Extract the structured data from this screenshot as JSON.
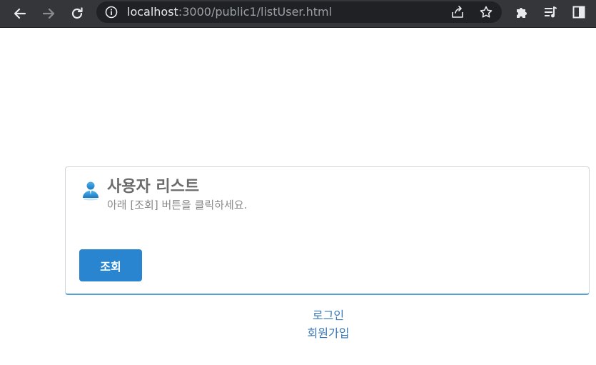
{
  "browser": {
    "url_host": "localhost",
    "url_path": ":3000/public1/listUser.html",
    "icons": [
      "back-arrow-icon",
      "forward-arrow-icon",
      "reload-icon",
      "info-icon",
      "share-icon",
      "star-icon",
      "puzzle-icon",
      "media-queue-icon",
      "side-panel-icon"
    ]
  },
  "card": {
    "title": "사용자 리스트",
    "subtitle": "아래 [조회] 버튼을 클릭하세요.",
    "query_button_label": "조회",
    "icon": "user-icon",
    "accent_color": "#2a85d0"
  },
  "links": {
    "login": "로그인",
    "signup": "회원가입",
    "color": "#3a78b5"
  }
}
